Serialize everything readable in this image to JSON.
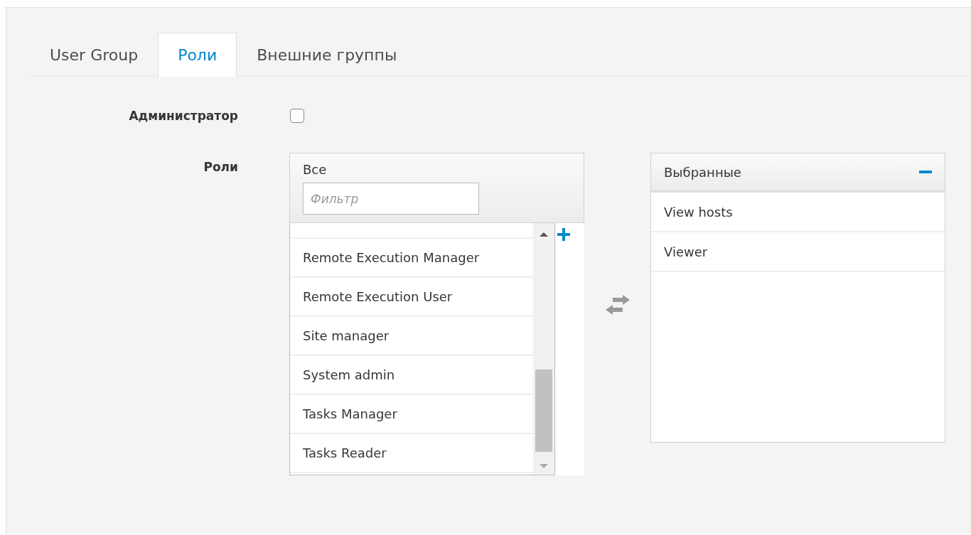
{
  "tabs": [
    {
      "label": "User Group",
      "selected": false
    },
    {
      "label": "Роли",
      "selected": true
    },
    {
      "label": "Внешние группы",
      "selected": false
    }
  ],
  "admin": {
    "label": "Администратор",
    "checked": false
  },
  "roles": {
    "label": "Роли",
    "available": {
      "title": "Все",
      "filter_placeholder": "Фильтр",
      "items": [
        "Remote Execution Manager",
        "Remote Execution User",
        "Site manager",
        "System admin",
        "Tasks Manager",
        "Tasks Reader"
      ]
    },
    "selected": {
      "title": "Выбранные",
      "items": [
        "View hosts",
        "Viewer"
      ]
    }
  }
}
